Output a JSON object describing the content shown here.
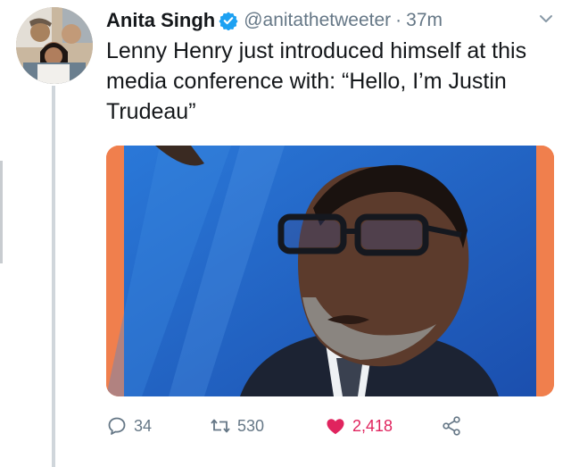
{
  "tweet": {
    "author_name": "Anita Singh",
    "handle": "@anitathetweeter",
    "separator": "·",
    "time": "37m",
    "text": "Lenny Henry just introduced himself at this media conference with: “Hello, I’m Justin Trudeau”"
  },
  "actions": {
    "replies": "34",
    "retweets": "530",
    "likes": "2,418"
  },
  "colors": {
    "verified": "#1da1f2",
    "like": "#e0245e",
    "muted": "#657786",
    "media_border": "#f07f4d",
    "media_background": "#2167c9"
  },
  "icons": {
    "verified": "verified-badge-icon",
    "chevron": "chevron-down-icon",
    "reply": "reply-icon",
    "retweet": "retweet-icon",
    "like": "heart-icon",
    "share": "share-icon"
  }
}
